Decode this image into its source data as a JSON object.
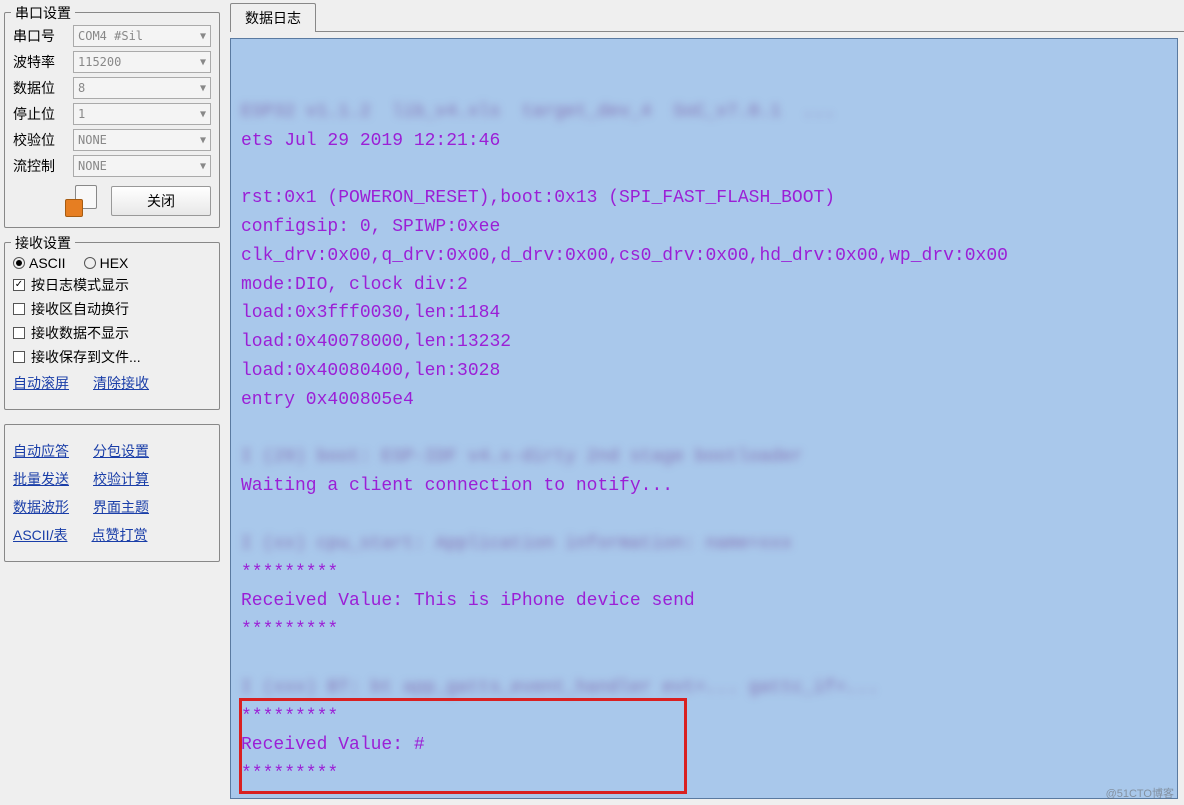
{
  "serial": {
    "group_title": "串口设置",
    "port_label": "串口号",
    "port_value": "COM4 #Sil",
    "baud_label": "波特率",
    "baud_value": "115200",
    "data_label": "数据位",
    "data_value": "8",
    "stop_label": "停止位",
    "stop_value": "1",
    "parity_label": "校验位",
    "parity_value": "NONE",
    "flow_label": "流控制",
    "flow_value": "NONE",
    "close_btn": "关闭"
  },
  "recv": {
    "group_title": "接收设置",
    "ascii_label": "ASCII",
    "hex_label": "HEX",
    "log_mode_label": "按日志模式显示",
    "auto_wrap_label": "接收区自动换行",
    "hide_recv_label": "接收数据不显示",
    "save_file_label": "接收保存到文件...",
    "auto_scroll_link": "自动滚屏",
    "clear_recv_link": "清除接收"
  },
  "links": {
    "auto_reply": "自动应答",
    "packet_set": "分包设置",
    "batch_send": "批量发送",
    "check_calc": "校验计算",
    "data_wave": "数据波形",
    "ui_theme": "界面主题",
    "ascii_table": "ASCII/表",
    "like_share": "点赞打赏"
  },
  "tab": {
    "data_log": "数据日志"
  },
  "log": {
    "blur1": "ESP32 v1.1.2  lib_v4.xls  target_dev_4  SoC_v7.0.1  ...",
    "line1": "ets Jul 29 2019 12:21:46",
    "line2": "rst:0x1 (POWERON_RESET),boot:0x13 (SPI_FAST_FLASH_BOOT)",
    "line3": "configsip: 0, SPIWP:0xee",
    "line4": "clk_drv:0x00,q_drv:0x00,d_drv:0x00,cs0_drv:0x00,hd_drv:0x00,wp_drv:0x00",
    "line5": "mode:DIO, clock div:2",
    "line6": "load:0x3fff0030,len:1184",
    "line7": "load:0x40078000,len:13232",
    "line8": "load:0x40080400,len:3028",
    "line9": "entry 0x400805e4",
    "blur2": "I (29) boot: ESP-IDF v4.x-dirty 2nd stage bootloader",
    "line10": "Waiting a client connection to notify...",
    "blur3": "I (xx) cpu_start: Application information: name=xxx",
    "stars1": "*********",
    "line11": "Received Value: This is iPhone device send",
    "stars2": "*********",
    "blur4": "I (xxx) BT: bt app_gatts_event_handler evt=... gattc_if=...",
    "stars3": "*********",
    "line12": "Received Value: #",
    "stars4": "*********"
  },
  "watermark": "@51CTO博客"
}
